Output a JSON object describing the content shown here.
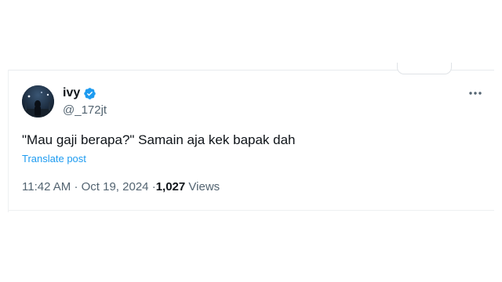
{
  "tweet": {
    "display_name": "ivy",
    "handle": "@_172jt",
    "text": "\"Mau gaji berapa?\" Samain aja kek bapak dah",
    "translate_label": "Translate post",
    "time": "11:42 AM",
    "separator": "·",
    "date": "Oct 19, 2024",
    "views_count": "1,027",
    "views_label": "Views",
    "verified": true
  },
  "icons": {
    "verified": "verified-badge-icon",
    "more": "more-options-icon",
    "avatar": "profile-avatar"
  },
  "colors": {
    "text_primary": "#0f1419",
    "text_secondary": "#536471",
    "accent": "#1d9bf0"
  }
}
